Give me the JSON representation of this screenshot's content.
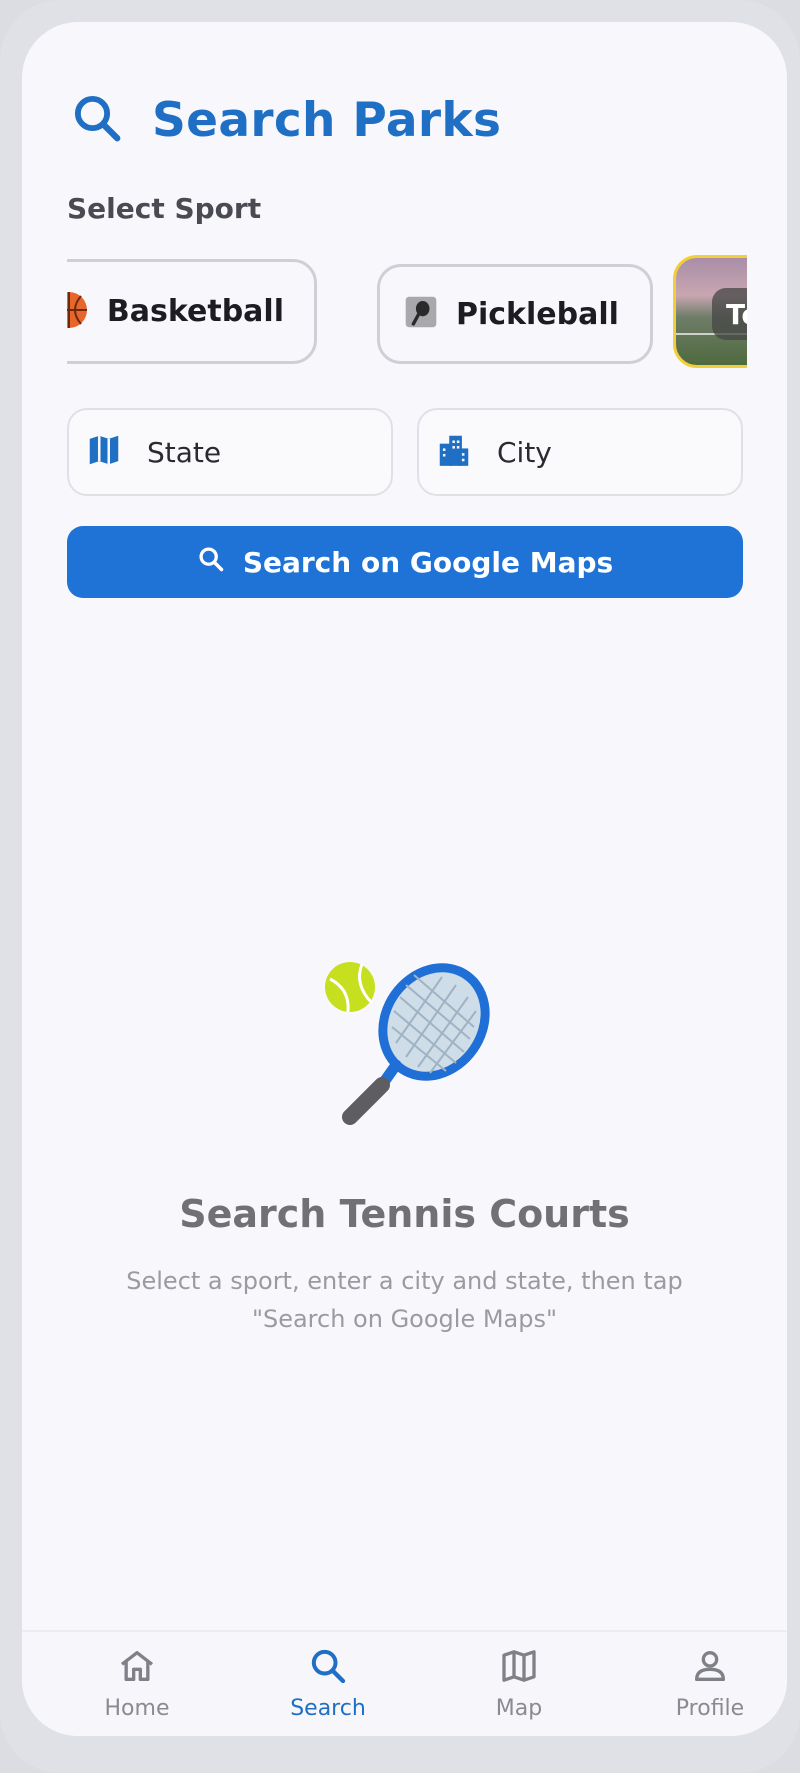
{
  "header": {
    "title": "Search Parks"
  },
  "sport_section": {
    "label": "Select Sport"
  },
  "sports": [
    {
      "label": "Basketball",
      "icon": "basketball-icon"
    },
    {
      "label": "Pickleball",
      "icon": "pickleball-icon"
    },
    {
      "label": "Tenn",
      "icon": "tennis-court-image",
      "selected": true
    }
  ],
  "fields": {
    "state": {
      "placeholder": "State",
      "icon": "map-icon"
    },
    "city": {
      "placeholder": "City",
      "icon": "building-icon"
    }
  },
  "search_button": {
    "label": "Search on Google Maps"
  },
  "empty_state": {
    "title": "Search Tennis Courts",
    "subtitle": "Select a sport, enter a city and state, then tap \"Search on Google Maps\""
  },
  "nav": [
    {
      "label": "Home",
      "icon": "home-icon"
    },
    {
      "label": "Search",
      "icon": "search-icon",
      "active": true
    },
    {
      "label": "Map",
      "icon": "map-icon"
    },
    {
      "label": "Profile",
      "icon": "profile-icon"
    }
  ],
  "colors": {
    "accent": "#1f73d6",
    "selected_border": "#f0cf3a",
    "title": "#1f6fc4"
  }
}
